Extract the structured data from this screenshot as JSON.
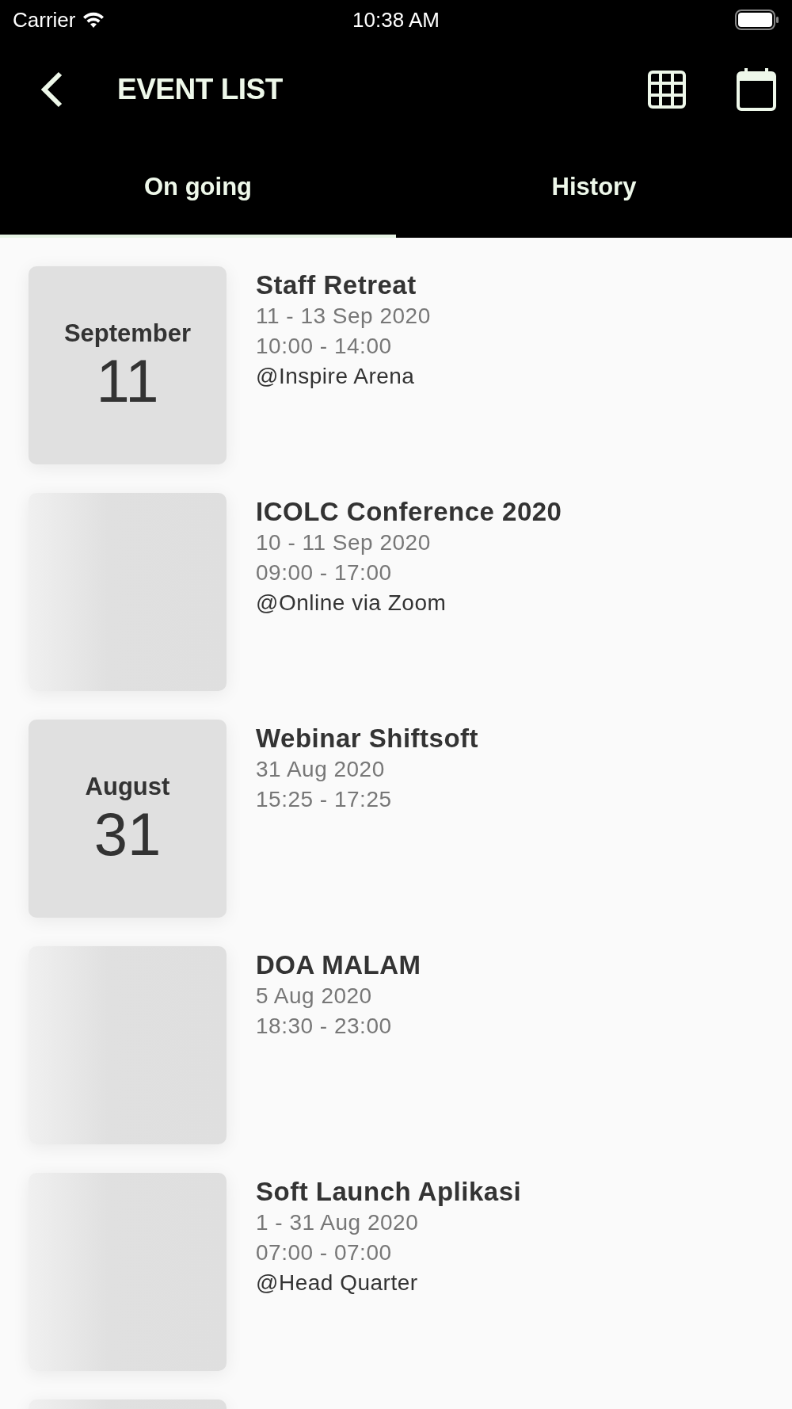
{
  "status_bar": {
    "carrier": "Carrier",
    "time": "10:38 AM"
  },
  "header": {
    "title": "EVENT LIST"
  },
  "tabs": [
    {
      "label": "On going",
      "selected": true
    },
    {
      "label": "History",
      "selected": false
    }
  ],
  "events": [
    {
      "kind": "date",
      "month": "September",
      "day": "11",
      "title": "Staff Retreat",
      "dates": "11 - 13 Sep 2020",
      "time": "10:00 - 14:00",
      "location": "@Inspire Arena"
    },
    {
      "kind": "blank",
      "title": "ICOLC Conference 2020",
      "dates": "10 - 11 Sep 2020",
      "time": "09:00 - 17:00",
      "location": "@Online via Zoom"
    },
    {
      "kind": "date",
      "month": "August",
      "day": "31",
      "title": "Webinar Shiftsoft",
      "dates": "31 Aug 2020",
      "time": "15:25 - 17:25"
    },
    {
      "kind": "blank",
      "title": "DOA MALAM",
      "dates": "5 Aug 2020",
      "time": "18:30 - 23:00"
    },
    {
      "kind": "blank",
      "title": "Soft Launch Aplikasi",
      "dates": "1 - 31 Aug 2020",
      "time": "07:00 - 07:00",
      "location": "@Head Quarter"
    },
    {
      "kind": "blank"
    }
  ]
}
